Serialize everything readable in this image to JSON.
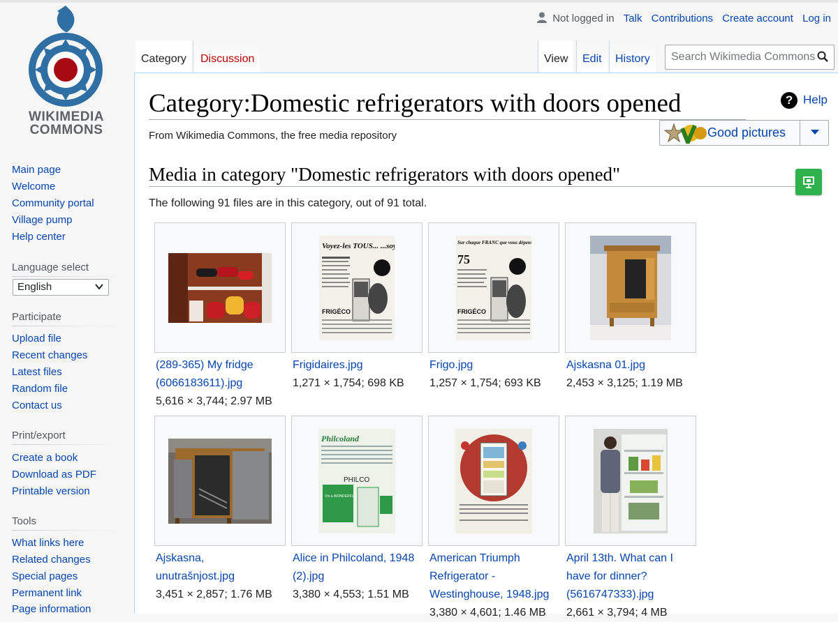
{
  "logo": {
    "line1": "WIKIMEDIA",
    "line2": "COMMONS"
  },
  "personal_tools": {
    "not_logged_in": "Not logged in",
    "talk": "Talk",
    "contributions": "Contributions",
    "create_account": "Create account",
    "log_in": "Log in"
  },
  "tabs": {
    "category": "Category",
    "discussion": "Discussion",
    "view": "View",
    "edit": "Edit",
    "history": "History"
  },
  "search": {
    "placeholder": "Search Wikimedia Commons"
  },
  "sidebar": {
    "nav": [
      "Main page",
      "Welcome",
      "Community portal",
      "Village pump",
      "Help center"
    ],
    "language_heading": "Language select",
    "language_value": "English",
    "participate_heading": "Participate",
    "participate": [
      "Upload file",
      "Recent changes",
      "Latest files",
      "Random file",
      "Contact us"
    ],
    "print_heading": "Print/export",
    "print": [
      "Create a book",
      "Download as PDF",
      "Printable version"
    ],
    "tools_heading": "Tools",
    "tools": [
      "What links here",
      "Related changes",
      "Special pages",
      "Permanent link",
      "Page information"
    ]
  },
  "page": {
    "title": "Category:Domestic refrigerators with doors opened",
    "tagline": "From Wikimedia Commons, the free media repository",
    "help": "Help",
    "good_pictures": "Good pictures",
    "media_heading": "Media in category \"Domestic refrigerators with doors opened\"",
    "count_text": "The following 91 files are in this category, out of 91 total."
  },
  "gallery": [
    {
      "name": "(289-365) My fridge (6066183611).jpg",
      "meta": "5,616 × 3,744; 2.97 MB"
    },
    {
      "name": "Frigidaires.jpg",
      "meta": "1,271 × 1,754; 698 KB"
    },
    {
      "name": "Frigo.jpg",
      "meta": "1,257 × 1,754; 693 KB"
    },
    {
      "name": "Ajskasna 01.jpg",
      "meta": "2,453 × 3,125; 1.19 MB"
    },
    {
      "name": "Ajskasna, unutrašnjost.jpg",
      "meta": "3,451 × 2,857; 1.76 MB"
    },
    {
      "name": "Alice in Philcoland, 1948 (2).jpg",
      "meta": "3,380 × 4,553; 1.51 MB"
    },
    {
      "name": "American Triumph Refrigerator - Westinghouse, 1948.jpg",
      "meta": "3,380 × 4,601; 1.46 MB"
    },
    {
      "name": "April 13th. What can I have for dinner? (5616747333).jpg",
      "meta": "2,661 × 3,794; 4 MB"
    }
  ],
  "thumb_texts": {
    "frigidaires_headline": "Voyez-les TOUS... ...soyez exigeantes!",
    "frigidaires_brand": "FRIGÉCO",
    "frigo_headline": "Sur chaque FRANC que vous dépensez pour la nourriture...",
    "frigo_number": "75",
    "frigo_brand": "FRIGÉCO",
    "philco_script": "Philcoland",
    "philco_brand": "PHILCO",
    "philco_badge": "It's a WONDERFUL Refrigerator!"
  },
  "colors": {
    "link": "#0645ad",
    "border": "#a7d7f9",
    "green": "#2fb24c",
    "logo_blue": "#2f6fa3",
    "logo_red": "#a70a12"
  }
}
